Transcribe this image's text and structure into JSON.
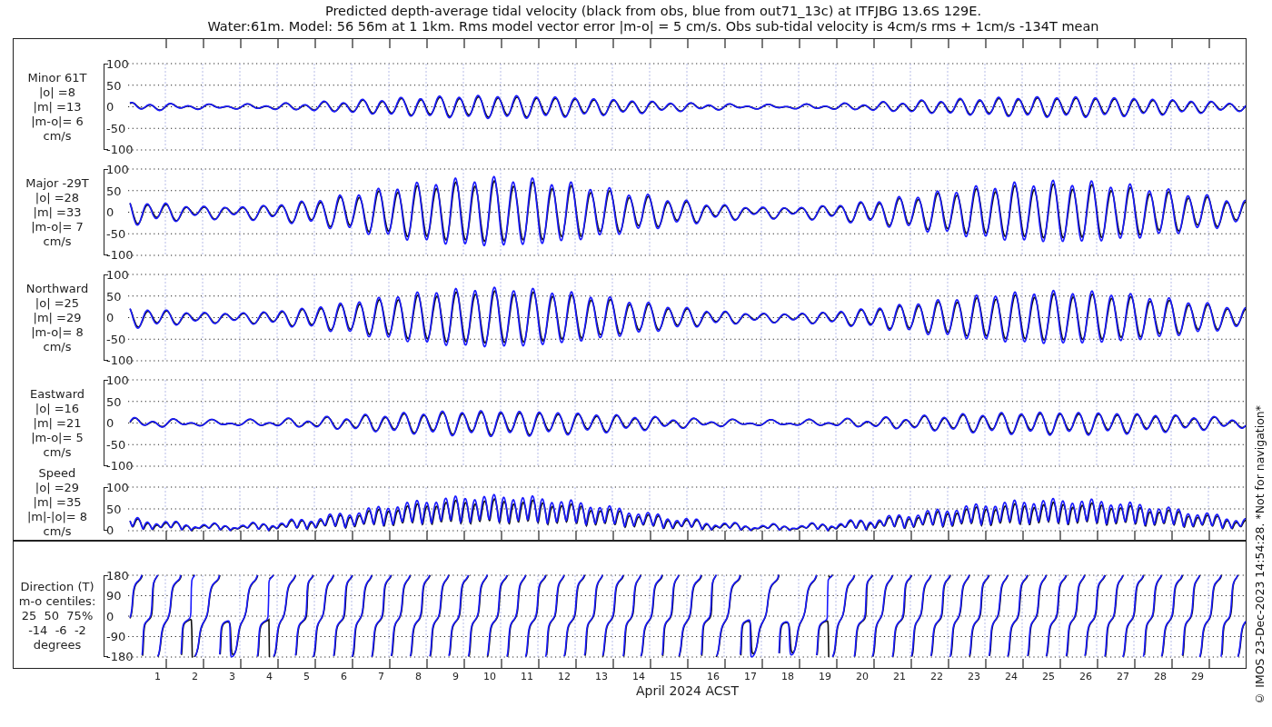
{
  "title_lines": [
    "Predicted depth-average tidal velocity (black from obs, blue from out71_13c) at ITFJBG 13.6S 129E.",
    "Water:61m. Model: 56 56m at 1 1km. Rms model vector error |m-o| = 5 cm/s. Obs sub-tidal velocity is 4cm/s rms + 1cm/s -134T mean"
  ],
  "panels": [
    {
      "kind": "minor",
      "label_lines": [
        "Minor 61T",
        "|o| =8",
        "|m| =13",
        "|m-o|= 6",
        "cm/s"
      ],
      "yticks": [
        "100",
        "50",
        "0",
        "-50",
        "-100"
      ]
    },
    {
      "kind": "major",
      "label_lines": [
        "Major -29T",
        "|o| =28",
        "|m| =33",
        "|m-o|= 7",
        "cm/s"
      ],
      "yticks": [
        "100",
        "50",
        "0",
        "-50",
        "-100"
      ]
    },
    {
      "kind": "north",
      "label_lines": [
        "Northward",
        "|o| =25",
        "|m| =29",
        "|m-o|= 8",
        "cm/s"
      ],
      "yticks": [
        "100",
        "50",
        "0",
        "-50",
        "-100"
      ]
    },
    {
      "kind": "east",
      "label_lines": [
        "Eastward",
        "|o| =16",
        "|m| =21",
        "|m-o|= 5",
        "cm/s"
      ],
      "yticks": [
        "100",
        "50",
        "0",
        "-50",
        "-100"
      ]
    },
    {
      "kind": "speed",
      "label_lines": [
        "Speed",
        "|o| =29",
        "|m| =35",
        "|m|-|o|= 8",
        "cm/s"
      ],
      "yticks": [
        "100",
        "50",
        "0"
      ]
    },
    {
      "kind": "direction",
      "label_lines": [
        "Direction (T)",
        "m-o centiles:",
        "25  50  75%",
        "-14  -6  -2",
        "degrees"
      ],
      "yticks": [
        "180",
        "90",
        "0",
        "-90",
        "-180"
      ]
    }
  ],
  "x_tick_labels": [
    "1",
    "2",
    "3",
    "4",
    "5",
    "6",
    "7",
    "8",
    "9",
    "10",
    "11",
    "12",
    "13",
    "14",
    "15",
    "16",
    "17",
    "18",
    "19",
    "20",
    "21",
    "22",
    "23",
    "24",
    "25",
    "26",
    "27",
    "28",
    "29"
  ],
  "xlabel": "April 2024 ACST",
  "footnote": "© IMOS 23-Dec-2023 14:54:28. *Not for navigation*"
}
